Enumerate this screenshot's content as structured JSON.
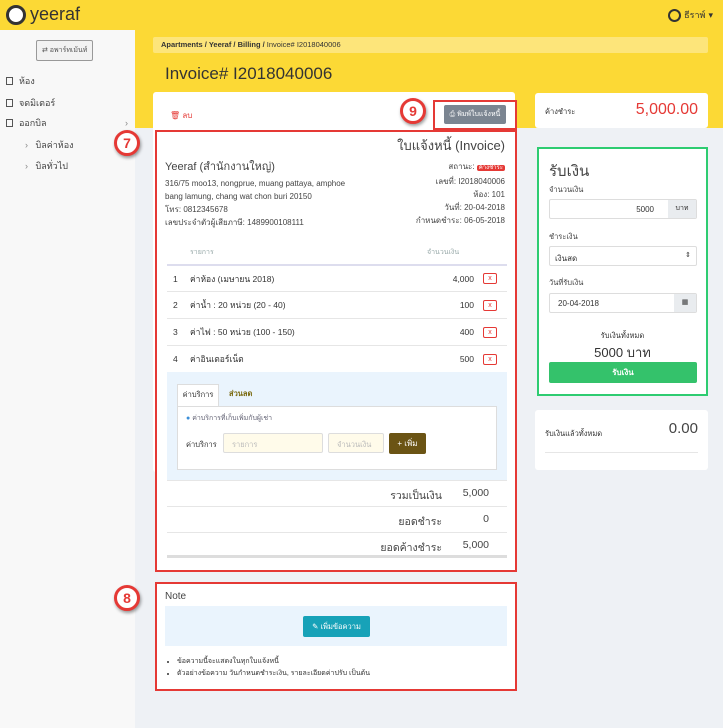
{
  "app": {
    "brand": "yeeraf",
    "user": "ธีราพ์"
  },
  "sidebar": {
    "switch_label": "⇄ อพาร์ทเม้นท์",
    "items": [
      {
        "label": "ห้อง"
      },
      {
        "label": "จดมิเตอร์"
      },
      {
        "label": "ออกบิล"
      }
    ],
    "subitems": [
      {
        "label": "บิลค่าห้อง"
      },
      {
        "label": "บิลทั่วไป"
      }
    ]
  },
  "breadcrumb": [
    "Apartments",
    "Yeeraf",
    "Billing",
    "Invoice# I2018040006"
  ],
  "page_title": "Invoice# I2018040006",
  "toolbar": {
    "delete_label": "ลบ",
    "print_label": "พิมพ์ใบแจ้งหนี้"
  },
  "annotations": {
    "print": "9",
    "invoice": "7",
    "note": "8"
  },
  "invoice": {
    "heading": "ใบแจ้งหนี้ (Invoice)",
    "company": "Yeeraf (สำนักงานใหญ่)",
    "address1": "316/75 moo13, nongprue, muang pattaya, amphoe",
    "address2": "bang lamung, chang wat chon buri 20150",
    "phone": "โทร: 0812345678",
    "tax_id": "เลขประจำตัวผู้เสียภาษี: 1489900108111",
    "status_label": "สถานะ:",
    "status": "ค้างชำระ",
    "number": "เลขที่: I2018040006",
    "room": "ห้อง: 101",
    "date": "วันที่: 20-04-2018",
    "due": "กำหนดชำระ: 06-05-2018",
    "col_item": "รายการ",
    "col_amount": "จำนวนเงิน",
    "items": [
      {
        "no": "1",
        "name": "ค่าห้อง (เมษายน 2018)",
        "amount": "4,000"
      },
      {
        "no": "2",
        "name": "ค่าน้ำ : 20 หน่วย (20 - 40)",
        "amount": "100"
      },
      {
        "no": "3",
        "name": "ค่าไฟ : 50 หน่วย (100 - 150)",
        "amount": "400"
      },
      {
        "no": "4",
        "name": "ค่าอินเตอร์เน็ต",
        "amount": "500"
      }
    ],
    "remove_label": "x",
    "tabs": [
      "ค่าบริการ",
      "ส่วนลด"
    ],
    "tab_info": "ค่าบริการที่เก็บเพิ่มกับผู้เช่า",
    "field_label": "ค่าบริการ",
    "item_placeholder": "รายการ",
    "amount_placeholder": "จำนวนเงิน",
    "add_label": "+ เพิ่ม",
    "totals": [
      {
        "label": "รวมเป็นเงิน",
        "value": "5,000"
      },
      {
        "label": "ยอดชำระ",
        "value": "0"
      },
      {
        "label": "ยอดค้างชำระ",
        "value": "5,000"
      }
    ]
  },
  "note": {
    "title": "Note",
    "add_label": "เพิ่มข้อความ",
    "bullets": [
      "ข้อความนี้จะแสดงในทุกใบแจ้งหนี้",
      "ตัวอย่างข้อความ วันกำหนดชำระเงิน, รายละเอียดค่าปรับ เป็นต้น"
    ]
  },
  "outstanding": {
    "label": "ค้างชำระ",
    "value": "5,000.00"
  },
  "receive": {
    "title": "รับเงิน",
    "amount_label": "จำนวนเงิน",
    "amount": "5000",
    "unit": "บาท",
    "method_label": "ชำระเงิน",
    "method": "เงินสด",
    "date_label": "วันที่รับเงิน",
    "date": "20-04-2018",
    "total_label": "รับเงินทั้งหมด",
    "total": "5000 บาท",
    "submit": "รับเงิน"
  },
  "received": {
    "label": "รับเงินแล้วทั้งหมด",
    "value": "0.00"
  }
}
